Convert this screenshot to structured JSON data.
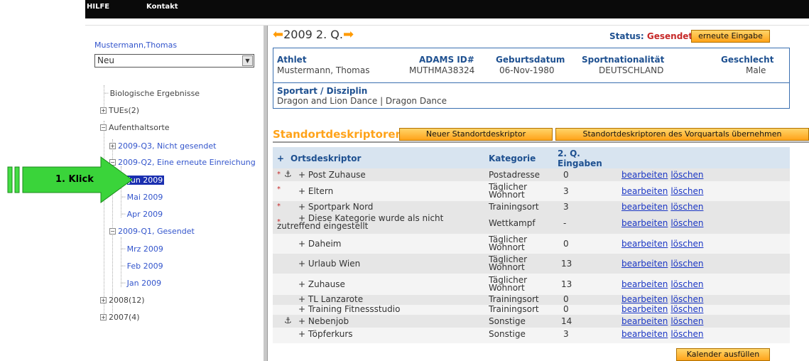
{
  "top_nav": {
    "hilfe": "HILFE",
    "kontakt": "Kontakt"
  },
  "sidebar": {
    "user_name": "Mustermann,Thomas",
    "select_value": "Neu",
    "tree": [
      {
        "label": "Biologische Ergebnisse"
      },
      {
        "label": "TUEs(2)"
      },
      {
        "label": "Aufenthaltsorte"
      },
      {
        "label": "2009-Q3, Nicht gesendet"
      },
      {
        "label": "2009-Q2, Eine erneute Einreichung"
      },
      {
        "label": "Jun 2009"
      },
      {
        "label": "Mai 2009"
      },
      {
        "label": "Apr 2009"
      },
      {
        "label": "2009-Q1, Gesendet"
      },
      {
        "label": "Mrz 2009"
      },
      {
        "label": "Feb 2009"
      },
      {
        "label": "Jan 2009"
      },
      {
        "label": "2008(12)"
      },
      {
        "label": "2007(4)"
      }
    ]
  },
  "callout": {
    "label": "1. Klick",
    "color": "#33cc33"
  },
  "header": {
    "period": "2009 2. Q.",
    "status_label": "Status:",
    "status_value": "Gesendet",
    "resubmit_button": "erneute Eingabe"
  },
  "athlete": {
    "h_athlet": "Athlet",
    "v_athlet": "Mustermann, Thomas",
    "h_adams": "ADAMS ID#",
    "v_adams": "MUTHMA38324",
    "h_geb": "Geburtsdatum",
    "v_geb": "06-Nov-1980",
    "h_nat": "Sportnationalität",
    "v_nat": "DEUTSCHLAND",
    "h_gesch": "Geschlecht",
    "v_gesch": "Male",
    "h_sport": "Sportart / Disziplin",
    "v_sport": "Dragon and Lion Dance | Dragon Dance"
  },
  "section": {
    "title": "Standortdeskriptoren",
    "new_button": "Neuer Standortdeskriptor",
    "copy_button": "Standortdeskriptoren des Vorquartals übernehmen"
  },
  "table": {
    "h_plus": "+",
    "h_ort": "Ortsdeskriptor",
    "h_kat": "Kategorie",
    "h_eing1": "2. Q.",
    "h_eing2": "Eingaben",
    "edit": "bearbeiten",
    "delete": "löschen",
    "req_mark": "*",
    "rows": [
      {
        "name": "+ Post Zuhause",
        "kat": "Postadresse",
        "n": "0"
      },
      {
        "name": "+ Eltern",
        "kat": "Täglicher Wohnort",
        "n": "3"
      },
      {
        "name": "+ Sportpark Nord",
        "kat": "Trainingsort",
        "n": "3"
      },
      {
        "name": "+ Diese Kategorie wurde als nicht zutreffend eingestellt",
        "kat": "Wettkampf",
        "n": "-"
      },
      {
        "name": "+ Daheim",
        "kat": "Täglicher Wohnort",
        "n": "0"
      },
      {
        "name": "+ Urlaub Wien",
        "kat": "Täglicher Wohnort",
        "n": "13"
      },
      {
        "name": "+ Zuhause",
        "kat": "Täglicher Wohnort",
        "n": "13"
      },
      {
        "name": "+ TL Lanzarote",
        "kat": "Trainingsort",
        "n": "0"
      },
      {
        "name": "+ Training Fitnessstudio",
        "kat": "Trainingsort",
        "n": "0"
      },
      {
        "name": "+ Nebenjob",
        "kat": "Sonstige",
        "n": "14"
      },
      {
        "name": "+ Töpferkurs",
        "kat": "Sonstige",
        "n": "3"
      }
    ]
  },
  "calendar_button": "Kalender ausfüllen"
}
